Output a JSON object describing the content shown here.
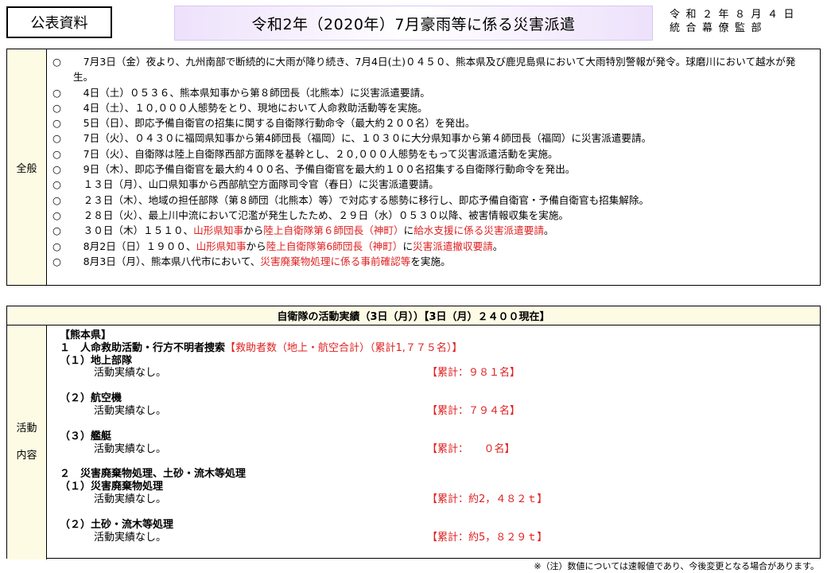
{
  "header": {
    "public_label": "公表資料",
    "title": "令和2年（2020年）7月豪雨等に係る災害派遣",
    "date": "令和２年８月４日",
    "author": "統合幕僚監部"
  },
  "overview": {
    "label": "全般",
    "items": [
      {
        "mark": "○",
        "parts": [
          {
            "t": "　7月3日（金）夜より、九州南部で断続的に大雨が降り続き、7月4日(土)０４５０、熊本県及び鹿児島県において大雨特別警報が発令。球磨川において越水が発生。"
          }
        ]
      },
      {
        "mark": "○",
        "parts": [
          {
            "t": "　4日（土）０５３６、熊本県知事から第８師団長（北熊本）に災害派遣要請。"
          }
        ]
      },
      {
        "mark": "○",
        "parts": [
          {
            "t": "　4日（土）、１０,０００人態勢をとり、現地において人命救助活動等を実施。"
          }
        ]
      },
      {
        "mark": "○",
        "parts": [
          {
            "t": "　5日（日）、即応予備自衛官の招集に関する自衛隊行動命令（最大約２００名）を発出。"
          }
        ]
      },
      {
        "mark": "○",
        "parts": [
          {
            "t": "　7日（火）、０４３０に福岡県知事から第4師団長（福岡）に、１０３０に大分県知事から第４師団長（福岡）に災害派遣要請。"
          }
        ]
      },
      {
        "mark": "○",
        "parts": [
          {
            "t": "　7日（火）、自衛隊は陸上自衛隊西部方面隊を基幹とし、２０,０００人態勢をもって災害派遣活動を実施。"
          }
        ]
      },
      {
        "mark": "○",
        "parts": [
          {
            "t": "　9日（木）、即応予備自衛官を最大約４００名、予備自衛官を最大約１００名招集する自衛隊行動命令を発出。"
          }
        ]
      },
      {
        "mark": "○",
        "parts": [
          {
            "t": "　１３日（月）、山口県知事から西部航空方面隊司令官（春日）に災害派遣要請。"
          }
        ]
      },
      {
        "mark": "○",
        "parts": [
          {
            "t": "　２３日（木）、地域の担任部隊（第８師団（北熊本）等）で対応する態勢に移行し、即応予備自衛官・予備自衛官も招集解除。"
          }
        ]
      },
      {
        "mark": "○",
        "parts": [
          {
            "t": "　２８日（火）、最上川中流において氾濫が発生したため、２９日（水）０５３０以降、被害情報収集を実施。"
          }
        ]
      },
      {
        "mark": "○",
        "parts": [
          {
            "t": "　３０日（木）１５１０、"
          },
          {
            "t": "山形県知事",
            "red": true
          },
          {
            "t": "から"
          },
          {
            "t": "陸上自衛隊第６師団長（神町）",
            "red": true
          },
          {
            "t": "に"
          },
          {
            "t": "給水支援に係る災害派遣要請",
            "red": true
          },
          {
            "t": "。"
          }
        ]
      },
      {
        "mark": "○",
        "parts": [
          {
            "t": "　8月2日（日）１９００、"
          },
          {
            "t": "山形県知事",
            "red": true
          },
          {
            "t": "から"
          },
          {
            "t": "陸上自衛隊第6師団長（神町）",
            "red": true
          },
          {
            "t": "に"
          },
          {
            "t": "災害派遣撤収要請",
            "red": true
          },
          {
            "t": "。"
          }
        ]
      },
      {
        "mark": "○",
        "parts": [
          {
            "t": "　8月3日（月）、熊本県八代市において、"
          },
          {
            "t": "災害廃棄物処理に係る事前確認等",
            "red": true
          },
          {
            "t": "を実施。"
          }
        ]
      }
    ]
  },
  "activity": {
    "header": "自衛隊の活動実績（3日（月））【3日（月）２４００現在】",
    "label_line1": "活動",
    "label_line2": "内容",
    "prefecture": "【熊本県】",
    "section1": {
      "title": "１　人命救助活動・行方不明者捜索",
      "rescued": "【救助者数（地上・航空合計）（累計1,７７５名）】",
      "items": [
        {
          "heading": "（１）地上部隊",
          "detail": "活動実績なし。",
          "cumulative": "【累計：９８１名】"
        },
        {
          "heading": "（２）航空機",
          "detail": "活動実績なし。",
          "cumulative": "【累計：７９４名】"
        },
        {
          "heading": "（３）艦艇",
          "detail": "活動実績なし。",
          "cumulative": "【累計：　　０名】"
        }
      ]
    },
    "section2": {
      "title": "２　災害廃棄物処理、土砂・流木等処理",
      "items": [
        {
          "heading": "（１）災害廃棄物処理",
          "detail": "活動実績なし。",
          "cumulative": "【累計：約2，４８２ｔ】"
        },
        {
          "heading": "（２）土砂・流木等処理",
          "detail": "活動実績なし。",
          "cumulative": "【累計：約5，８２９ｔ】"
        }
      ]
    }
  },
  "footnote": "※（注）数値については速報値であり、今後変更となる場合があります。",
  "colors": {
    "accent_red": "#e02020",
    "title_banner": "#ede1fb",
    "label_bg": "#fdfbe4"
  }
}
